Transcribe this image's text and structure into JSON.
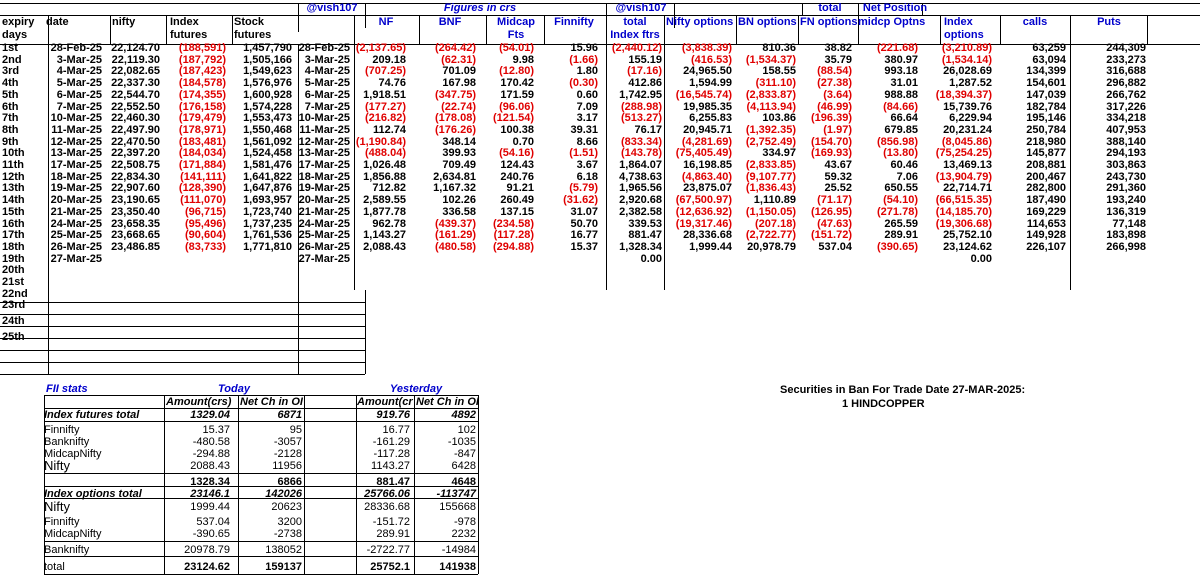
{
  "header": {
    "user_tag": "@vish107",
    "figures_in_crs": "Figures in crs",
    "total": "total",
    "net_position": "Net Position"
  },
  "headers_row1": {
    "expiry": "expiry",
    "date": "date",
    "nifty": "nifty",
    "index": "Index",
    "stock": "Stock",
    "nf": "NF",
    "bnf": "BNF",
    "midcap": "Midcap",
    "finnifty": "Finnifty",
    "total": "total",
    "nifty_options": "Nifty options",
    "bn_options": "BN options",
    "fn_options": "FN options",
    "midcp_optns": "midcp Optns",
    "calls": "calls",
    "puts": "Puts"
  },
  "headers_row2": {
    "days": "days",
    "futures": "futures",
    "futures2": "futures",
    "fts": "Fts",
    "index_ftrs": "Index ftrs",
    "options": "options"
  },
  "rows": [
    {
      "day": "1st",
      "date": "28-Feb-25",
      "nifty": "22,124.70",
      "idx": "(188,591)",
      "stk": "1,457,790",
      "date2": "28-Feb-25",
      "nf": "(2,137.65)",
      "bnf": "(264.42)",
      "mid": "(54.01)",
      "fin": "15.96",
      "tot": "(2,440.12)",
      "nopt": "(3,838.39)",
      "bnopt": "810.36",
      "fnopt": "38.82",
      "midopt": "(221.68)",
      "idxopt": "(3,210.89)",
      "calls": "63,259",
      "puts": "244,309"
    },
    {
      "day": "2nd",
      "date": "3-Mar-25",
      "nifty": "22,119.30",
      "idx": "(187,792)",
      "stk": "1,505,166",
      "date2": "3-Mar-25",
      "nf": "209.18",
      "bnf": "(62.31)",
      "mid": "9.98",
      "fin": "(1.66)",
      "tot": "155.19",
      "nopt": "(416.53)",
      "bnopt": "(1,534.37)",
      "fnopt": "35.79",
      "midopt": "380.97",
      "idxopt": "(1,534.14)",
      "calls": "63,094",
      "puts": "233,273"
    },
    {
      "day": "3rd",
      "date": "4-Mar-25",
      "nifty": "22,082.65",
      "idx": "(187,423)",
      "stk": "1,549,623",
      "date2": "4-Mar-25",
      "nf": "(707.25)",
      "bnf": "701.09",
      "mid": "(12.80)",
      "fin": "1.80",
      "tot": "(17.16)",
      "nopt": "24,965.50",
      "bnopt": "158.55",
      "fnopt": "(88.54)",
      "midopt": "993.18",
      "idxopt": "26,028.69",
      "calls": "134,399",
      "puts": "316,688"
    },
    {
      "day": "4th",
      "date": "5-Mar-25",
      "nifty": "22,337.30",
      "idx": "(184,578)",
      "stk": "1,576,976",
      "date2": "5-Mar-25",
      "nf": "74.76",
      "bnf": "167.98",
      "mid": "170.42",
      "fin": "(0.30)",
      "tot": "412.86",
      "nopt": "1,594.99",
      "bnopt": "(311.10)",
      "fnopt": "(27.38)",
      "midopt": "31.01",
      "idxopt": "1,287.52",
      "calls": "154,601",
      "puts": "296,882"
    },
    {
      "day": "5th",
      "date": "6-Mar-25",
      "nifty": "22,544.70",
      "idx": "(174,355)",
      "stk": "1,600,928",
      "date2": "6-Mar-25",
      "nf": "1,918.51",
      "bnf": "(347.75)",
      "mid": "171.59",
      "fin": "0.60",
      "tot": "1,742.95",
      "nopt": "(16,545.74)",
      "bnopt": "(2,833.87)",
      "fnopt": "(3.64)",
      "midopt": "988.88",
      "idxopt": "(18,394.37)",
      "calls": "147,039",
      "puts": "266,762"
    },
    {
      "day": "6th",
      "date": "7-Mar-25",
      "nifty": "22,552.50",
      "idx": "(176,158)",
      "stk": "1,574,228",
      "date2": "7-Mar-25",
      "nf": "(177.27)",
      "bnf": "(22.74)",
      "mid": "(96.06)",
      "fin": "7.09",
      "tot": "(288.98)",
      "nopt": "19,985.35",
      "bnopt": "(4,113.94)",
      "fnopt": "(46.99)",
      "midopt": "(84.66)",
      "idxopt": "15,739.76",
      "calls": "182,784",
      "puts": "317,226"
    },
    {
      "day": "7th",
      "date": "10-Mar-25",
      "nifty": "22,460.30",
      "idx": "(179,479)",
      "stk": "1,553,473",
      "date2": "10-Mar-25",
      "nf": "(216.82)",
      "bnf": "(178.08)",
      "mid": "(121.54)",
      "fin": "3.17",
      "tot": "(513.27)",
      "nopt": "6,255.83",
      "bnopt": "103.86",
      "fnopt": "(196.39)",
      "midopt": "66.64",
      "idxopt": "6,229.94",
      "calls": "195,146",
      "puts": "334,218"
    },
    {
      "day": "8th",
      "date": "11-Mar-25",
      "nifty": "22,497.90",
      "idx": "(178,971)",
      "stk": "1,550,468",
      "date2": "11-Mar-25",
      "nf": "112.74",
      "bnf": "(176.26)",
      "mid": "100.38",
      "fin": "39.31",
      "tot": "76.17",
      "nopt": "20,945.71",
      "bnopt": "(1,392.35)",
      "fnopt": "(1.97)",
      "midopt": "679.85",
      "idxopt": "20,231.24",
      "calls": "250,784",
      "puts": "407,953"
    },
    {
      "day": "9th",
      "date": "12-Mar-25",
      "nifty": "22,470.50",
      "idx": "(183,481)",
      "stk": "1,561,092",
      "date2": "12-Mar-25",
      "nf": "(1,190.84)",
      "bnf": "348.14",
      "mid": "0.70",
      "fin": "8.66",
      "tot": "(833.34)",
      "nopt": "(4,281.69)",
      "bnopt": "(2,752.49)",
      "fnopt": "(154.70)",
      "midopt": "(856.98)",
      "idxopt": "(8,045.86)",
      "calls": "218,980",
      "puts": "388,140"
    },
    {
      "day": "10th",
      "date": "13-Mar-25",
      "nifty": "22,397.20",
      "idx": "(184,034)",
      "stk": "1,524,458",
      "date2": "13-Mar-25",
      "nf": "(488.04)",
      "bnf": "399.93",
      "mid": "(54.16)",
      "fin": "(1.51)",
      "tot": "(143.78)",
      "nopt": "(75,405.49)",
      "bnopt": "334.97",
      "fnopt": "(169.93)",
      "midopt": "(13.80)",
      "idxopt": "(75,254.25)",
      "calls": "145,877",
      "puts": "294,193"
    },
    {
      "day": "11th",
      "date": "17-Mar-25",
      "nifty": "22,508.75",
      "idx": "(171,884)",
      "stk": "1,581,476",
      "date2": "17-Mar-25",
      "nf": "1,026.48",
      "bnf": "709.49",
      "mid": "124.43",
      "fin": "3.67",
      "tot": "1,864.07",
      "nopt": "16,198.85",
      "bnopt": "(2,833.85)",
      "fnopt": "43.67",
      "midopt": "60.46",
      "idxopt": "13,469.13",
      "calls": "208,881",
      "puts": "303,863"
    },
    {
      "day": "12th",
      "date": "18-Mar-25",
      "nifty": "22,834.30",
      "idx": "(141,111)",
      "stk": "1,641,822",
      "date2": "18-Mar-25",
      "nf": "1,856.88",
      "bnf": "2,634.81",
      "mid": "240.76",
      "fin": "6.18",
      "tot": "4,738.63",
      "nopt": "(4,863.40)",
      "bnopt": "(9,107.77)",
      "fnopt": "59.32",
      "midopt": "7.06",
      "idxopt": "(13,904.79)",
      "calls": "200,467",
      "puts": "243,730"
    },
    {
      "day": "13th",
      "date": "19-Mar-25",
      "nifty": "22,907.60",
      "idx": "(128,390)",
      "stk": "1,647,876",
      "date2": "19-Mar-25",
      "nf": "712.82",
      "bnf": "1,167.32",
      "mid": "91.21",
      "fin": "(5.79)",
      "tot": "1,965.56",
      "nopt": "23,875.07",
      "bnopt": "(1,836.43)",
      "fnopt": "25.52",
      "midopt": "650.55",
      "idxopt": "22,714.71",
      "calls": "282,800",
      "puts": "291,360"
    },
    {
      "day": "14th",
      "date": "20-Mar-25",
      "nifty": "23,190.65",
      "idx": "(111,070)",
      "stk": "1,693,957",
      "date2": "20-Mar-25",
      "nf": "2,589.55",
      "bnf": "102.26",
      "mid": "260.49",
      "fin": "(31.62)",
      "tot": "2,920.68",
      "nopt": "(67,500.97)",
      "bnopt": "1,110.89",
      "fnopt": "(71.17)",
      "midopt": "(54.10)",
      "idxopt": "(66,515.35)",
      "calls": "187,490",
      "puts": "193,240"
    },
    {
      "day": "15th",
      "date": "21-Mar-25",
      "nifty": "23,350.40",
      "idx": "(96,715)",
      "stk": "1,723,740",
      "date2": "21-Mar-25",
      "nf": "1,877.78",
      "bnf": "336.58",
      "mid": "137.15",
      "fin": "31.07",
      "tot": "2,382.58",
      "nopt": "(12,636.92)",
      "bnopt": "(1,150.05)",
      "fnopt": "(126.95)",
      "midopt": "(271.78)",
      "idxopt": "(14,185.70)",
      "calls": "169,229",
      "puts": "136,319"
    },
    {
      "day": "16th",
      "date": "24-Mar-25",
      "nifty": "23,658.35",
      "idx": "(95,496)",
      "stk": "1,737,235",
      "date2": "24-Mar-25",
      "nf": "962.78",
      "bnf": "(439.37)",
      "mid": "(234.58)",
      "fin": "50.70",
      "tot": "339.53",
      "nopt": "(19,317.46)",
      "bnopt": "(207.18)",
      "fnopt": "(47.63)",
      "midopt": "265.59",
      "idxopt": "(19,306.68)",
      "calls": "114,653",
      "puts": "77,148"
    },
    {
      "day": "17th",
      "date": "25-Mar-25",
      "nifty": "23,668.65",
      "idx": "(90,604)",
      "stk": "1,761,536",
      "date2": "25-Mar-25",
      "nf": "1,143.27",
      "bnf": "(161.29)",
      "mid": "(117.28)",
      "fin": "16.77",
      "tot": "881.47",
      "nopt": "28,336.68",
      "bnopt": "(2,722.77)",
      "fnopt": "(151.72)",
      "midopt": "289.91",
      "idxopt": "25,752.10",
      "calls": "149,928",
      "puts": "183,898"
    },
    {
      "day": "18th",
      "date": "26-Mar-25",
      "nifty": "23,486.85",
      "idx": "(83,733)",
      "stk": "1,771,810",
      "date2": "26-Mar-25",
      "nf": "2,088.43",
      "bnf": "(480.58)",
      "mid": "(294.88)",
      "fin": "15.37",
      "tot": "1,328.34",
      "nopt": "1,999.44",
      "bnopt": "20,978.79",
      "fnopt": "537.04",
      "midopt": "(390.65)",
      "idxopt": "23,124.62",
      "calls": "226,107",
      "puts": "266,998"
    },
    {
      "day": "19th",
      "date": "27-Mar-25",
      "nifty": "",
      "idx": "",
      "stk": "",
      "date2": "27-Mar-25",
      "nf": "",
      "bnf": "",
      "mid": "",
      "fin": "",
      "tot": "0.00",
      "nopt": "",
      "bnopt": "",
      "fnopt": "",
      "midopt": "",
      "idxopt": "0.00",
      "calls": "",
      "puts": ""
    },
    {
      "day": "20th",
      "date": "",
      "nifty": "",
      "idx": "",
      "stk": "",
      "date2": "",
      "nf": "",
      "bnf": "",
      "mid": "",
      "fin": "",
      "tot": "",
      "nopt": "",
      "bnopt": "",
      "fnopt": "",
      "midopt": "",
      "idxopt": "",
      "calls": "",
      "puts": ""
    },
    {
      "day": "21st",
      "date": "",
      "nifty": "",
      "idx": "",
      "stk": "",
      "date2": "",
      "nf": "",
      "bnf": "",
      "mid": "",
      "fin": "",
      "tot": "",
      "nopt": "",
      "bnopt": "",
      "fnopt": "",
      "midopt": "",
      "idxopt": "",
      "calls": "",
      "puts": ""
    },
    {
      "day": "22nd",
      "date": "",
      "nifty": "",
      "idx": "",
      "stk": "",
      "date2": "",
      "nf": "",
      "bnf": "",
      "mid": "",
      "fin": "",
      "tot": "",
      "nopt": "",
      "bnopt": "",
      "fnopt": "",
      "midopt": "",
      "idxopt": "",
      "calls": "",
      "puts": ""
    },
    {
      "day": "23rd",
      "date": "",
      "nifty": "",
      "idx": "",
      "stk": "",
      "date2": "",
      "nf": "",
      "bnf": "",
      "mid": "",
      "fin": "",
      "tot": "",
      "nopt": "",
      "bnopt": "",
      "fnopt": "",
      "midopt": "",
      "idxopt": "",
      "calls": "",
      "puts": ""
    },
    {
      "day": "24th",
      "date": "",
      "nifty": "",
      "idx": "",
      "stk": "",
      "date2": "",
      "nf": "",
      "bnf": "",
      "mid": "",
      "fin": "",
      "tot": "",
      "nopt": "",
      "bnopt": "",
      "fnopt": "",
      "midopt": "",
      "idxopt": "",
      "calls": "",
      "puts": ""
    },
    {
      "day": "25th",
      "date": "",
      "nifty": "",
      "idx": "",
      "stk": "",
      "date2": "",
      "nf": "",
      "bnf": "",
      "mid": "",
      "fin": "",
      "tot": "",
      "nopt": "",
      "bnopt": "",
      "fnopt": "",
      "midopt": "",
      "idxopt": "",
      "calls": "",
      "puts": ""
    }
  ],
  "fii": {
    "title": "FII stats",
    "today": "Today",
    "yesterday": "Yesterday",
    "amount_hdr": "Amount(crs)",
    "net_ch_hdr": "Net Ch in OI",
    "amount_hdr_y": "Amount(cr",
    "net_ch_hdr_y": "Net Ch in OI",
    "rows": [
      {
        "label": "Index futures total",
        "t_amt": "1329.04",
        "t_oi": "6871",
        "y_amt": "919.76",
        "y_oi": "4892",
        "style": "hdr"
      },
      {
        "label": "Finnifty",
        "t_amt": "15.37",
        "t_oi": "95",
        "y_amt": "16.77",
        "y_oi": "102",
        "style": "norm"
      },
      {
        "label": "Banknifty",
        "t_amt": "-480.58",
        "t_oi": "-3057",
        "y_amt": "-161.29",
        "y_oi": "-1035",
        "style": "norm"
      },
      {
        "label": "MidcapNifty",
        "t_amt": "-294.88",
        "t_oi": "-2128",
        "y_amt": "-117.28",
        "y_oi": "-847",
        "style": "norm"
      },
      {
        "label": "Nifty",
        "t_amt": "2088.43",
        "t_oi": "11956",
        "y_amt": "1143.27",
        "y_oi": "6428",
        "style": "big"
      },
      {
        "label": "",
        "t_amt": "1328.34",
        "t_oi": "6866",
        "y_amt": "881.47",
        "y_oi": "4648",
        "style": "bold"
      },
      {
        "label": "Index options total",
        "t_amt": "23146.1",
        "t_oi": "142026",
        "y_amt": "25766.06",
        "y_oi": "-113747",
        "style": "hdr"
      },
      {
        "label": "Nifty",
        "t_amt": "1999.44",
        "t_oi": "20623",
        "y_amt": "28336.68",
        "y_oi": "155668",
        "style": "big"
      },
      {
        "label": "Finnifty",
        "t_amt": "537.04",
        "t_oi": "3200",
        "y_amt": "-151.72",
        "y_oi": "-978",
        "style": "norm"
      },
      {
        "label": "MidcapNifty",
        "t_amt": "-390.65",
        "t_oi": "-2738",
        "y_amt": "289.91",
        "y_oi": "2232",
        "style": "norm"
      },
      {
        "label": "Banknifty",
        "t_amt": "20978.79",
        "t_oi": "138052",
        "y_amt": "-2722.77",
        "y_oi": "-14984",
        "style": "norm"
      },
      {
        "label": "total",
        "t_amt": "23124.62",
        "t_oi": "159137",
        "y_amt": "25752.1",
        "y_oi": "141938",
        "style": "bold"
      }
    ]
  },
  "ban": {
    "title": "Securities in Ban For Trade Date 27-MAR-2025:",
    "item": "1 HINDCOPPER"
  }
}
